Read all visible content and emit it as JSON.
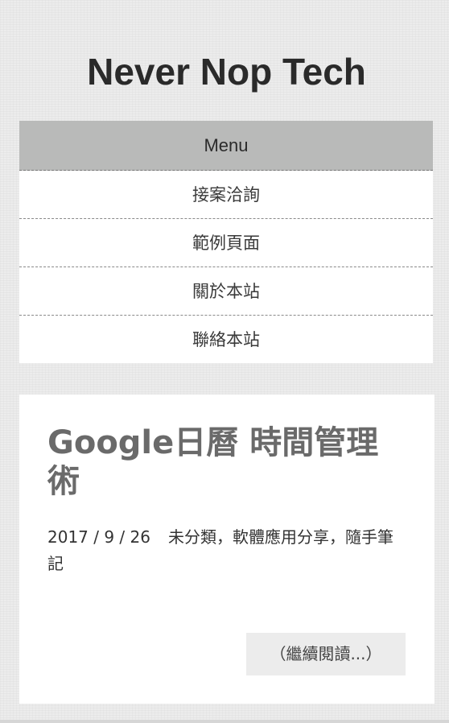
{
  "site": {
    "title": "Never Nop Tech"
  },
  "nav": {
    "toggle_label": "Menu",
    "items": [
      {
        "label": "接案洽詢"
      },
      {
        "label": "範例頁面"
      },
      {
        "label": "關於本站"
      },
      {
        "label": "聯絡本站"
      }
    ]
  },
  "post": {
    "title": "Google日曆 時間管理術",
    "date": "2017 / 9 / 26",
    "categories": [
      {
        "label": "未分類"
      },
      {
        "label": "軟體應用分享"
      },
      {
        "label": "隨手筆記"
      }
    ],
    "separator": "，",
    "read_more": "（繼續閱讀...）"
  }
}
